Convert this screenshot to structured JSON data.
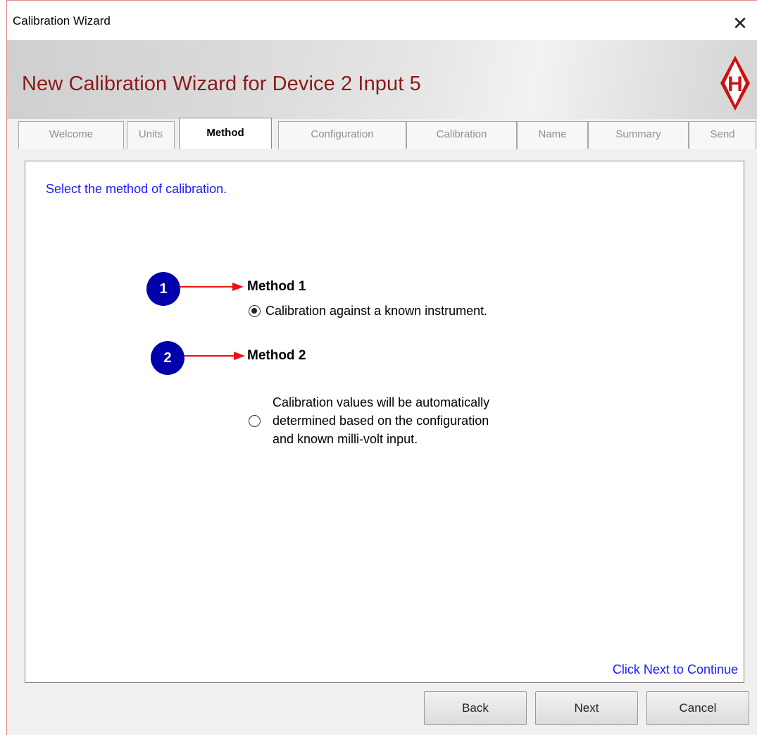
{
  "window": {
    "title": "Calibration Wizard",
    "close_label": "✕"
  },
  "banner": {
    "heading": "New Calibration Wizard for Device 2 Input 5",
    "logo_letter": "H",
    "logo_color": "#cc1111"
  },
  "tabs": [
    {
      "label": "Welcome",
      "active": false
    },
    {
      "label": "Units",
      "active": false
    },
    {
      "label": "Method",
      "active": true
    },
    {
      "label": "Configuration",
      "active": false
    },
    {
      "label": "Calibration",
      "active": false
    },
    {
      "label": "Name",
      "active": false
    },
    {
      "label": "Summary",
      "active": false
    },
    {
      "label": "Send",
      "active": false
    }
  ],
  "panel": {
    "instruction": "Select the method of calibration.",
    "methods": [
      {
        "badge": "1",
        "title": "Method 1",
        "option_lines": [
          "Calibration against a known instrument."
        ],
        "selected": true
      },
      {
        "badge": "2",
        "title": "Method 2",
        "option_lines": [
          "Calibration values will be automatically",
          "determined based on the configuration",
          "and known milli-volt input."
        ],
        "selected": false
      }
    ],
    "footer_hint": "Click Next to Continue"
  },
  "buttons": {
    "back": "Back",
    "next": "Next",
    "cancel": "Cancel"
  },
  "colors": {
    "heading": "#8b1a1a",
    "link_blue": "#1a1aff",
    "badge_blue": "#0000aa",
    "arrow_red": "#ee1111"
  }
}
